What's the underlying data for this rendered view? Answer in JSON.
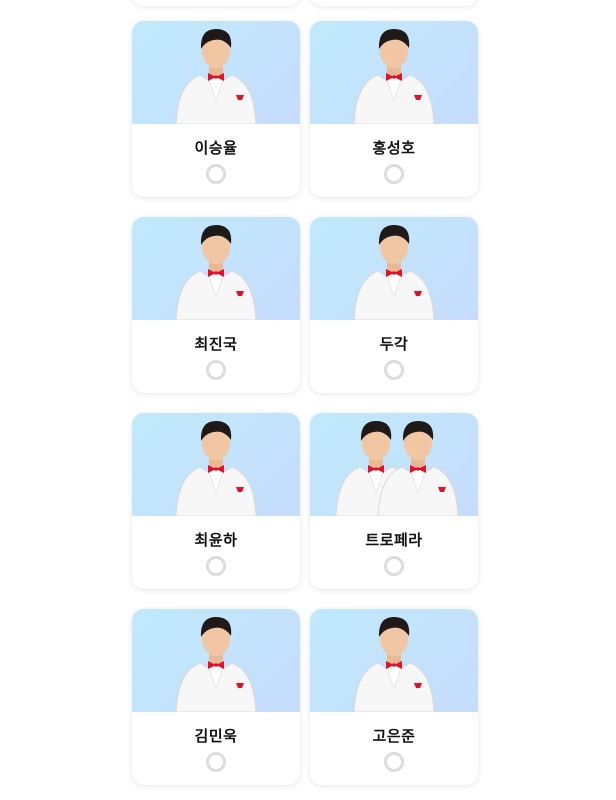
{
  "cards": [
    {
      "name": "이승율",
      "selected": false,
      "image_icon": "singer-portrait-icon"
    },
    {
      "name": "홍성호",
      "selected": false,
      "image_icon": "singer-portrait-icon"
    },
    {
      "name": "최진국",
      "selected": false,
      "image_icon": "singer-portrait-icon"
    },
    {
      "name": "두각",
      "selected": false,
      "image_icon": "singer-portrait-icon"
    },
    {
      "name": "최윤하",
      "selected": false,
      "image_icon": "singer-portrait-icon"
    },
    {
      "name": "트로페라",
      "selected": false,
      "image_icon": "singer-portrait-icon"
    },
    {
      "name": "김민욱",
      "selected": false,
      "image_icon": "singer-portrait-icon"
    },
    {
      "name": "고은준",
      "selected": false,
      "image_icon": "singer-portrait-icon"
    }
  ],
  "colors": {
    "photo_bg_start": "#bfeafc",
    "photo_bg_end": "#c6dcfd",
    "radio_border": "#dcdcdc",
    "accent_red": "#e0122a",
    "suit_white": "#f7f7f7"
  }
}
